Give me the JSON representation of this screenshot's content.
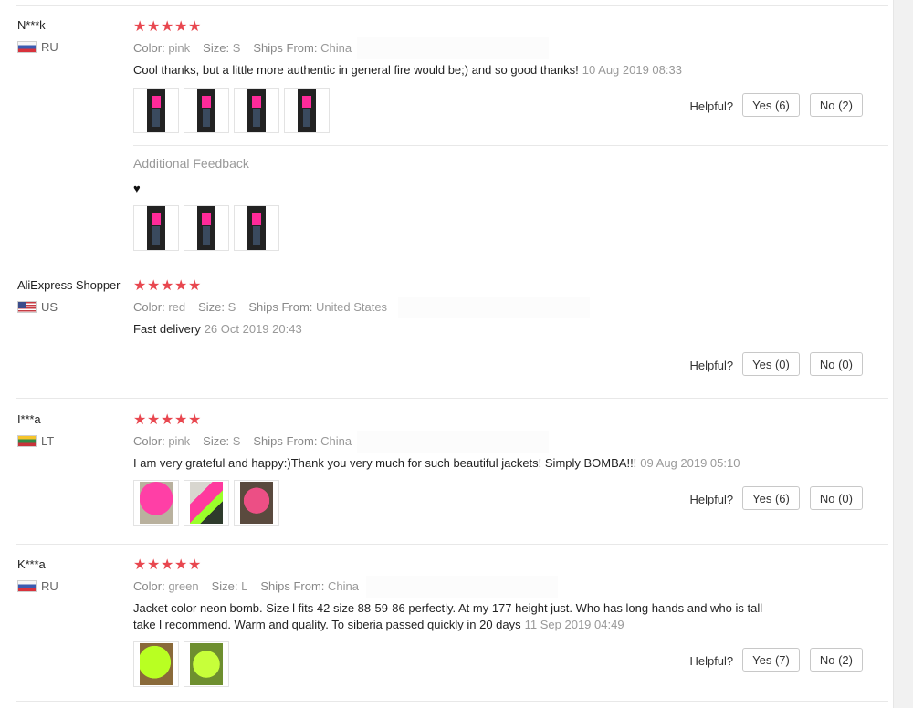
{
  "helpful_label": "Helpful?",
  "attr_labels": {
    "color": "Color:",
    "size": "Size:",
    "ships_from": "Ships From:"
  },
  "star_glyph": "★",
  "reviews": [
    {
      "user": "N***k",
      "country": "RU",
      "rating": 5,
      "color": "pink",
      "size": "S",
      "ships_from": "China",
      "text": "Cool thanks, but a little more authentic in general fire would be;) and so good thanks!",
      "date": "10 Aug 2019 08:33",
      "yes": "Yes (6)",
      "no": "No (2)",
      "additional_title": "Additional Feedback",
      "additional_text": "♥"
    },
    {
      "user": "AliExpress Shopper",
      "country": "US",
      "rating": 5,
      "color": "red",
      "size": "S",
      "ships_from": "United States",
      "text": "Fast delivery",
      "date": "26 Oct 2019 20:43",
      "yes": "Yes (0)",
      "no": "No (0)"
    },
    {
      "user": "I***a",
      "country": "LT",
      "rating": 5,
      "color": "pink",
      "size": "S",
      "ships_from": "China",
      "text": "I am very grateful and happy:)Thank you very much for such beautiful jackets! Simply BOMBA!!!",
      "date": "09 Aug 2019 05:10",
      "yes": "Yes (6)",
      "no": "No (0)"
    },
    {
      "user": "K***a",
      "country": "RU",
      "rating": 5,
      "color": "green",
      "size": "L",
      "ships_from": "China",
      "text_line1": "Jacket color neon bomb. Size l fits 42 size 88-59-86 perfectly. At my 177 height just. Who has long hands and who is tall",
      "text_line2": "take l recommend. Warm and quality. To siberia passed quickly in 20 days",
      "date": "11 Sep 2019 04:49",
      "yes": "Yes (7)",
      "no": "No (2)"
    }
  ],
  "colors": {
    "star": "#e8474f",
    "muted_text": "#999999",
    "border": "#e8e8e8"
  }
}
